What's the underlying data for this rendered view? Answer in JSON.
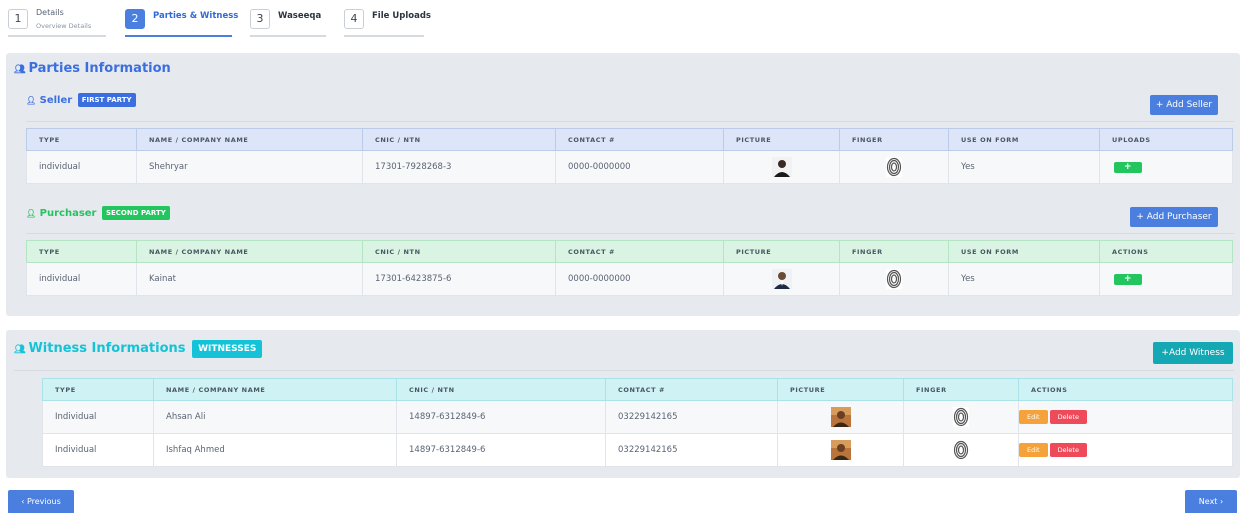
{
  "stepper": [
    {
      "num": "1",
      "title": "Details",
      "sub": "Overview Details"
    },
    {
      "num": "2",
      "title": "Parties & Witness",
      "sub": ""
    },
    {
      "num": "3",
      "title": "Waseeqa",
      "sub": ""
    },
    {
      "num": "4",
      "title": "File Uploads",
      "sub": ""
    }
  ],
  "parties": {
    "title": "Parties Information",
    "seller": {
      "label": "Seller",
      "badge": "FIRST PARTY",
      "add_button": "+ Add Seller",
      "columns": [
        "TYPE",
        "NAME / COMPANY NAME",
        "CNIC / NTN",
        "CONTACT #",
        "PICTURE",
        "FINGER",
        "USE ON FORM",
        "UPLOADS"
      ],
      "rows": [
        {
          "type": "individual",
          "name": "Shehryar",
          "cnic": "17301-7928268-3",
          "contact": "0000-0000000",
          "use_on_form": "Yes",
          "action": "+"
        }
      ]
    },
    "purchaser": {
      "label": "Purchaser",
      "badge": "SECOND PARTY",
      "add_button": "+ Add Purchaser",
      "columns": [
        "TYPE",
        "NAME / COMPANY NAME",
        "CNIC / NTN",
        "CONTACT #",
        "PICTURE",
        "FINGER",
        "USE ON FORM",
        "ACTIONS"
      ],
      "rows": [
        {
          "type": "individual",
          "name": "Kainat",
          "cnic": "17301-6423875-6",
          "contact": "0000-0000000",
          "use_on_form": "Yes",
          "action": "+"
        }
      ]
    }
  },
  "witness": {
    "title": "Witness Informations",
    "badge": "WITNESSES",
    "add_button": "+Add Witness",
    "columns": [
      "TYPE",
      "NAME / COMPANY NAME",
      "CNIC / NTN",
      "CONTACT #",
      "PICTURE",
      "FINGER",
      "ACTIONS"
    ],
    "edit_label": "Edit",
    "delete_label": "Delete",
    "rows": [
      {
        "type": "Individual",
        "name": "Ahsan Ali",
        "cnic": "14897-6312849-6",
        "contact": "03229142165"
      },
      {
        "type": "Individual",
        "name": "Ishfaq Ahmed",
        "cnic": "14897-6312849-6",
        "contact": "03229142165"
      }
    ]
  },
  "nav": {
    "previous": "‹ Previous",
    "next": "Next ›"
  },
  "colors": {
    "primary": "#4a7fe0",
    "success": "#22c55e",
    "info": "#14c3d8",
    "teal": "#14a8b4",
    "warning": "#f5a23a",
    "danger": "#ef4a5a"
  }
}
